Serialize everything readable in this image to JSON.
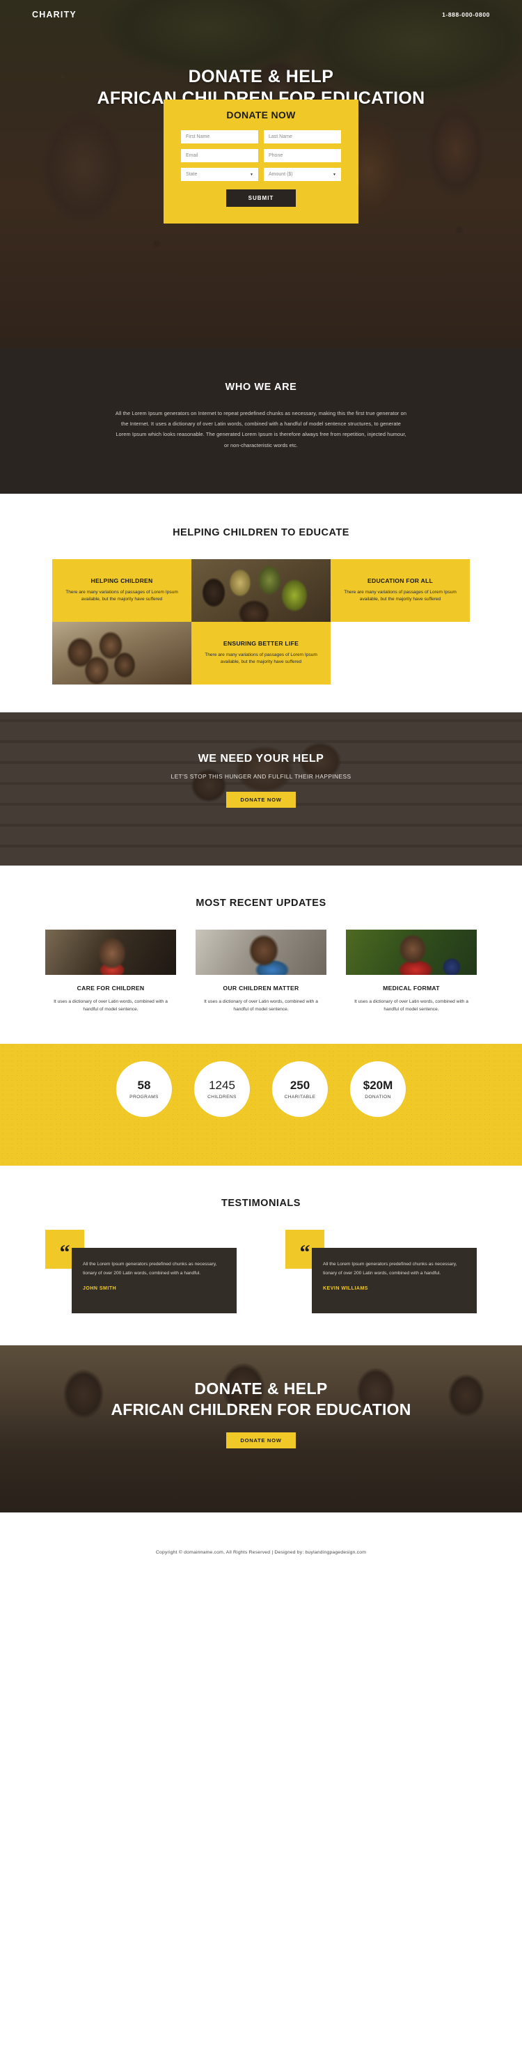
{
  "header": {
    "brand": "CHARITY",
    "phone": "1-888-000-0800"
  },
  "hero": {
    "headline_line1": "DONATE & HELP",
    "headline_line2": "AFRICAN CHILDREN FOR EDUCATION",
    "form": {
      "title": "DONATE NOW",
      "first_name_placeholder": "First Name",
      "last_name_placeholder": "Last Name",
      "email_placeholder": "Email",
      "phone_placeholder": "Phone",
      "state_placeholder": "State",
      "amount_placeholder": "Amount ($)",
      "submit_label": "SUBMIT"
    }
  },
  "who_we_are": {
    "title": "WHO WE ARE",
    "body": "All the Lorem Ipsum generators on Internet to repeat predefined chunks as necessary, making this the first true generator on the Internet. It uses a dictionary of over Latin words, combined with a handful of model sentence structures, to generate Lorem Ipsum which looks reasonable. The generated Lorem Ipsum is therefore always free from repetition, injected humour, or non-characteristic words etc."
  },
  "educate": {
    "title": "HELPING CHILDREN TO EDUCATE",
    "cells": [
      {
        "heading": "HELPING CHILDREN",
        "body": "There are many variations of passages of Lorem Ipsum available, but the majority have suffered"
      },
      {
        "heading": "EDUCATION FOR ALL",
        "body": "There are many variations of passages of Lorem Ipsum available, but the majority have suffered"
      },
      {
        "heading": "ENSURING BETTER LIFE",
        "body": "There are many variations of passages of Lorem Ipsum available, but the majority have suffered"
      }
    ]
  },
  "need_help": {
    "title": "WE NEED YOUR HELP",
    "subtitle": "LET'S STOP THIS HUNGER AND FULFILL THEIR HAPPINESS",
    "button_label": "DONATE NOW"
  },
  "updates": {
    "title": "MOST RECENT UPDATES",
    "cards": [
      {
        "heading": "CARE FOR CHILDREN",
        "body": "It uses a dictionary of over Latin words, combined with a handful of model sentence."
      },
      {
        "heading": "OUR CHILDREN MATTER",
        "body": "It uses a dictionary of over Latin words, combined with a handful of model sentence."
      },
      {
        "heading": "MEDICAL FORMAT",
        "body": "It uses a dictionary of over Latin words, combined with a handful of model sentence."
      }
    ]
  },
  "stats": [
    {
      "number": "58",
      "label": "PROGRAMS"
    },
    {
      "number": "1245",
      "label": "CHILDRENS"
    },
    {
      "number": "250",
      "label": "CHARITABLE"
    },
    {
      "number": "$20M",
      "label": "DONATION"
    }
  ],
  "testimonials": {
    "title": "TESTIMONIALS",
    "items": [
      {
        "quote_mark": "“",
        "body": "All the Lorem Ipsum generators predefined chunks as necessary, tionary of over 200 Latin words, combined with a handful.",
        "name": "JOHN SMITH"
      },
      {
        "quote_mark": "“",
        "body": "All the Lorem Ipsum generators predefined chunks as necessary, tionary of over 200 Latin words, combined with a handful.",
        "name": "KEVIN WILLIAMS"
      }
    ]
  },
  "cta": {
    "headline_line1": "DONATE & HELP",
    "headline_line2": "AFRICAN CHILDREN FOR EDUCATION",
    "button_label": "DONATE NOW"
  },
  "footer": {
    "text": "Copyright © domainname.com, All Rights Reserved  |  Designed by: buylandingpagedesign.com"
  },
  "colors": {
    "accent_yellow": "#f0c929",
    "dark": "#2b2521"
  }
}
